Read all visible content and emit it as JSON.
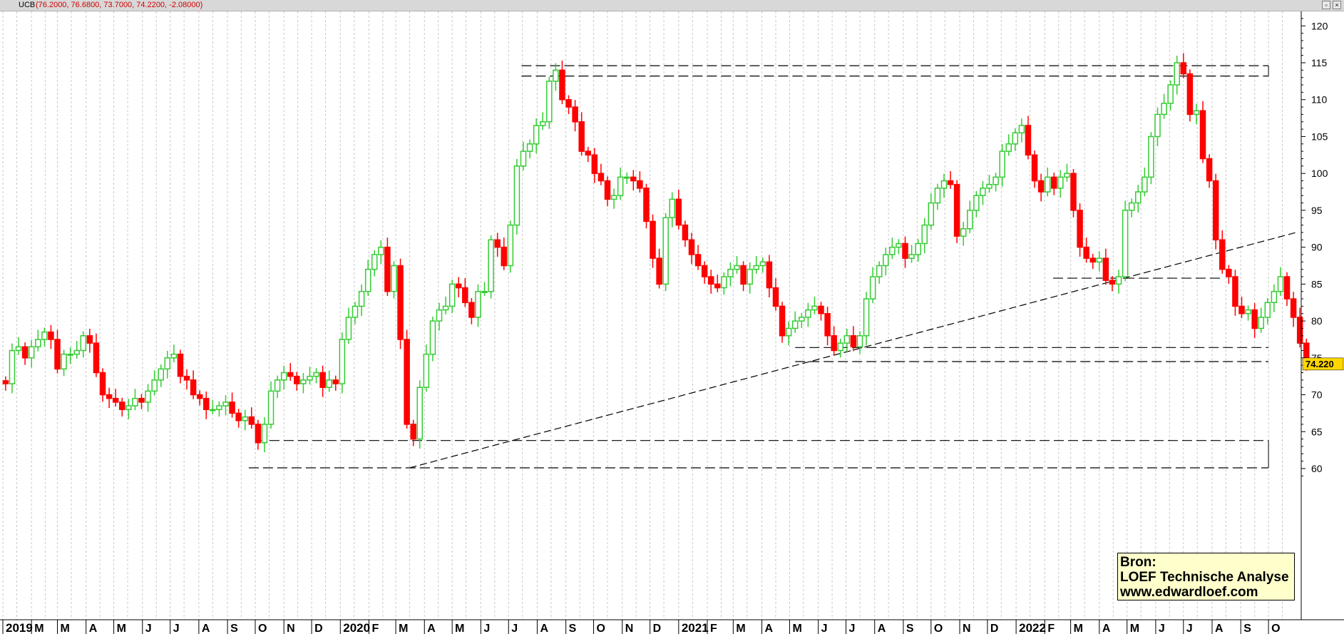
{
  "window": {
    "symbol": "UCB",
    "ohlc_text": "(76.2000, 76.6800, 73.7000, 74.2200, -2.08000)",
    "restore_icon": "restore-icon",
    "close_icon": "close-icon"
  },
  "source": {
    "line1": "Bron:",
    "line2": "LOEF Technische Analyse",
    "line3": "www.edwardloef.com"
  },
  "colors": {
    "up": "#33cc33",
    "down": "#ff0000",
    "trendline": "#000000",
    "last_price_bg": "#ffd700",
    "grid": "#c8c8c8"
  },
  "chart_data": {
    "type": "candlestick",
    "interval": "weekly",
    "ylim": [
      58,
      122
    ],
    "yticks": [
      60,
      65,
      70,
      75,
      80,
      85,
      90,
      95,
      100,
      105,
      110,
      115,
      120
    ],
    "last_price": {
      "value": 74.22,
      "label": "74.220"
    },
    "xlim": [
      "2019-01-01",
      "2022-10-31"
    ],
    "x_month_labels": [
      {
        "date": "2019-01-01",
        "label": "2019",
        "year": true
      },
      {
        "date": "2019-02-01",
        "label": "M"
      },
      {
        "date": "2019-03-01",
        "label": "M"
      },
      {
        "date": "2019-04-01",
        "label": "A"
      },
      {
        "date": "2019-05-01",
        "label": "M"
      },
      {
        "date": "2019-06-01",
        "label": "J"
      },
      {
        "date": "2019-07-01",
        "label": "J"
      },
      {
        "date": "2019-08-01",
        "label": "A"
      },
      {
        "date": "2019-09-01",
        "label": "S"
      },
      {
        "date": "2019-10-01",
        "label": "O"
      },
      {
        "date": "2019-11-01",
        "label": "N"
      },
      {
        "date": "2019-12-01",
        "label": "D"
      },
      {
        "date": "2020-01-01",
        "label": "2020",
        "year": true
      },
      {
        "date": "2020-02-01",
        "label": "F"
      },
      {
        "date": "2020-03-01",
        "label": "M"
      },
      {
        "date": "2020-04-01",
        "label": "A"
      },
      {
        "date": "2020-05-01",
        "label": "M"
      },
      {
        "date": "2020-06-01",
        "label": "J"
      },
      {
        "date": "2020-07-01",
        "label": "J"
      },
      {
        "date": "2020-08-01",
        "label": "A"
      },
      {
        "date": "2020-09-01",
        "label": "S"
      },
      {
        "date": "2020-10-01",
        "label": "O"
      },
      {
        "date": "2020-11-01",
        "label": "N"
      },
      {
        "date": "2020-12-01",
        "label": "D"
      },
      {
        "date": "2021-01-01",
        "label": "2021",
        "year": true
      },
      {
        "date": "2021-02-01",
        "label": "F"
      },
      {
        "date": "2021-03-01",
        "label": "M"
      },
      {
        "date": "2021-04-01",
        "label": "A"
      },
      {
        "date": "2021-05-01",
        "label": "M"
      },
      {
        "date": "2021-06-01",
        "label": "J"
      },
      {
        "date": "2021-07-01",
        "label": "J"
      },
      {
        "date": "2021-08-01",
        "label": "A"
      },
      {
        "date": "2021-09-01",
        "label": "S"
      },
      {
        "date": "2021-10-01",
        "label": "O"
      },
      {
        "date": "2021-11-01",
        "label": "N"
      },
      {
        "date": "2021-12-01",
        "label": "D"
      },
      {
        "date": "2022-01-01",
        "label": "2022",
        "year": true
      },
      {
        "date": "2022-02-01",
        "label": "F"
      },
      {
        "date": "2022-03-01",
        "label": "M"
      },
      {
        "date": "2022-04-01",
        "label": "A"
      },
      {
        "date": "2022-05-01",
        "label": "M"
      },
      {
        "date": "2022-06-01",
        "label": "J"
      },
      {
        "date": "2022-07-01",
        "label": "J"
      },
      {
        "date": "2022-08-01",
        "label": "A"
      },
      {
        "date": "2022-09-01",
        "label": "S"
      },
      {
        "date": "2022-10-01",
        "label": "O"
      }
    ],
    "weekly_closes": [
      71.5,
      76.0,
      76.5,
      75.0,
      76.5,
      77.5,
      78.5,
      77.5,
      73.5,
      75.5,
      75.5,
      76.0,
      78.0,
      77.0,
      73.0,
      70.0,
      69.5,
      69.0,
      68.0,
      68.5,
      69.5,
      69.0,
      70.5,
      72.0,
      73.5,
      75.0,
      75.5,
      72.5,
      72.0,
      70.0,
      69.5,
      68.0,
      68.0,
      68.5,
      69.0,
      67.5,
      66.5,
      67.0,
      66.0,
      63.5,
      66.0,
      70.5,
      72.0,
      73.0,
      72.5,
      71.5,
      72.0,
      72.5,
      73.0,
      71.0,
      72.0,
      71.5,
      77.5,
      80.5,
      82.0,
      84.0,
      87.0,
      89.0,
      90.0,
      84.0,
      87.5,
      77.5,
      66.0,
      64.0,
      71.0,
      75.5,
      80.0,
      81.5,
      82.0,
      85.0,
      84.5,
      82.5,
      80.5,
      84.0,
      84.0,
      91.0,
      90.0,
      87.5,
      93.0,
      101.0,
      103.0,
      104.0,
      106.5,
      107.0,
      112.5,
      114.0,
      110.0,
      109.0,
      107.0,
      103.0,
      102.5,
      100.0,
      99.0,
      96.5,
      97.0,
      99.5,
      99.5,
      99.0,
      98.0,
      93.5,
      88.5,
      85.0,
      94.0,
      96.5,
      93.0,
      91.0,
      89.0,
      87.5,
      86.0,
      85.0,
      84.5,
      86.0,
      87.0,
      87.5,
      85.0,
      87.0,
      87.5,
      88.0,
      84.5,
      82.0,
      78.0,
      79.0,
      80.0,
      80.5,
      81.5,
      82.0,
      81.0,
      78.0,
      76.0,
      77.0,
      78.0,
      76.5,
      78.0,
      83.0,
      86.0,
      87.5,
      89.0,
      90.0,
      90.5,
      88.5,
      89.0,
      90.5,
      93.0,
      96.0,
      98.0,
      99.0,
      98.5,
      91.5,
      92.5,
      95.0,
      97.0,
      98.0,
      98.5,
      99.5,
      103.0,
      104.0,
      105.5,
      106.5,
      102.5,
      99.0,
      97.5,
      99.5,
      98.0,
      99.5,
      100.0,
      95.0,
      90.0,
      88.5,
      88.0,
      88.5,
      85.5,
      85.0,
      86.0,
      95.0,
      96.0,
      97.5,
      99.5,
      105.0,
      108.0,
      109.5,
      112.0,
      115.0,
      113.5,
      108.0,
      108.5,
      102.0,
      99.0,
      91.0,
      87.0,
      86.0,
      82.0,
      81.0,
      81.5,
      79.0,
      80.5,
      82.5,
      84.0,
      86.0,
      83.0,
      80.5,
      77.0,
      74.22
    ]
  }
}
